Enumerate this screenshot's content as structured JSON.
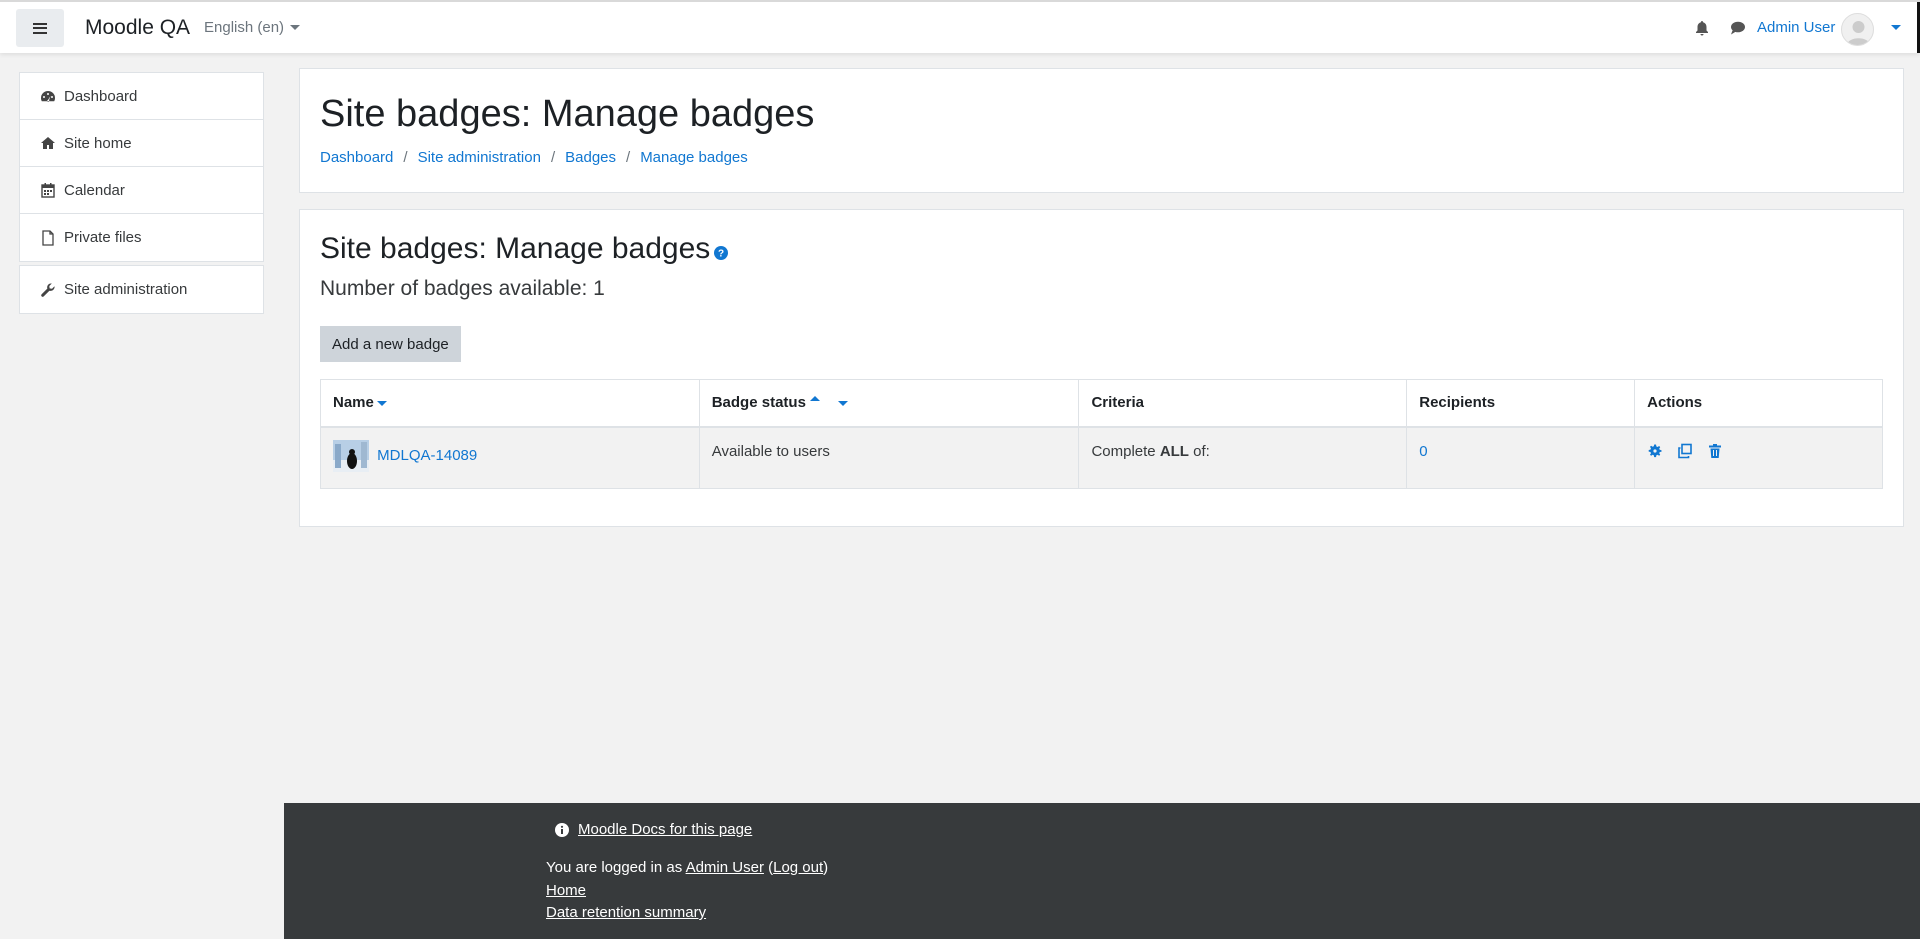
{
  "navbar": {
    "brand": "Moodle QA",
    "language": "English (en)",
    "user_name": "Admin User"
  },
  "drawer": {
    "items": [
      {
        "label": "Dashboard",
        "icon": "dashboard-icon"
      },
      {
        "label": "Site home",
        "icon": "home-icon"
      },
      {
        "label": "Calendar",
        "icon": "calendar-icon"
      },
      {
        "label": "Private files",
        "icon": "file-icon"
      }
    ],
    "admin": {
      "label": "Site administration",
      "icon": "wrench-icon"
    }
  },
  "header": {
    "title": "Site badges: Manage badges",
    "breadcrumb": [
      "Dashboard",
      "Site administration",
      "Badges",
      "Manage badges"
    ]
  },
  "main": {
    "heading": "Site badges: Manage badges",
    "count_text": "Number of badges available: 1",
    "add_button": "Add a new badge",
    "table": {
      "headers": [
        "Name",
        "Badge status",
        "Criteria",
        "Recipients",
        "Actions"
      ],
      "rows": [
        {
          "name": "MDLQA-14089",
          "status": "Available to users",
          "criteria_prefix": "Complete ",
          "criteria_bold": "ALL",
          "criteria_suffix": " of:",
          "recipients": "0",
          "actions": [
            "gear-icon",
            "copy-icon",
            "trash-icon"
          ]
        }
      ]
    }
  },
  "footer": {
    "docs_link": "Moodle Docs for this page",
    "logged_in_prefix": "You are logged in as ",
    "logged_in_user": "Admin User",
    "logout_open": " (",
    "logout": "Log out",
    "logout_close": ")",
    "home": "Home",
    "data_retention": "Data retention summary"
  },
  "colors": {
    "link": "#1177d1",
    "footer_bg": "#373a3c",
    "button_bg": "#ced4da"
  }
}
